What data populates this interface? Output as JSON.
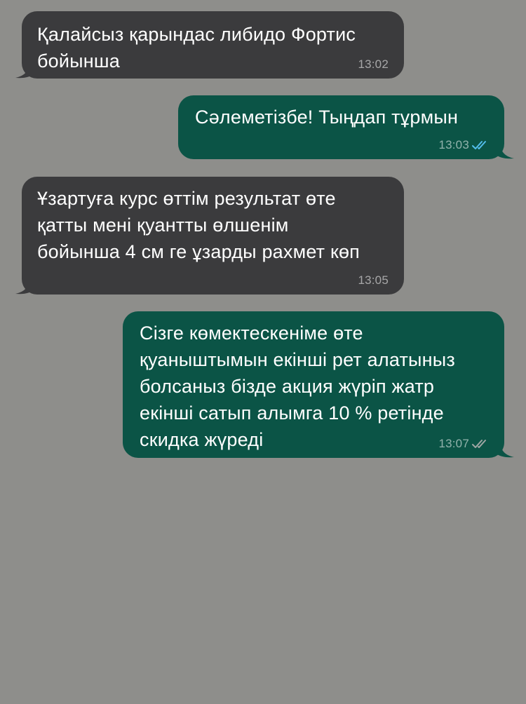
{
  "colors": {
    "background": "#8e8e8b",
    "incoming_bubble": "#3b3b3d",
    "outgoing_bubble": "#0b5446",
    "read_check": "#53bdeb",
    "delivered_check": "#9fa6a4"
  },
  "messages": [
    {
      "direction": "incoming",
      "text": "Қалайсыз қарындас либидо Фортис\nбойынша",
      "time": "13:02"
    },
    {
      "direction": "outgoing",
      "text": "Сәлеметізбе! Тыңдап тұрмын",
      "time": "13:03",
      "status_icon": "double-check-read-icon"
    },
    {
      "direction": "incoming",
      "text": "Ұзартуға курс өттім результат өте\nқатты мені қуантты өлшенім\nбойынша 4 см ге ұзарды рахмет көп",
      "time": "13:05"
    },
    {
      "direction": "outgoing",
      "text": "Сізге көмектескеніме өте\nқуаныштымын екінші рет алатыныз\nболсаныз бізде акция жүріп жатр\nекінші сатып алымга 10 % ретінде\nскидка жүреді",
      "time": "13:07",
      "status_icon": "double-check-delivered-icon"
    }
  ]
}
